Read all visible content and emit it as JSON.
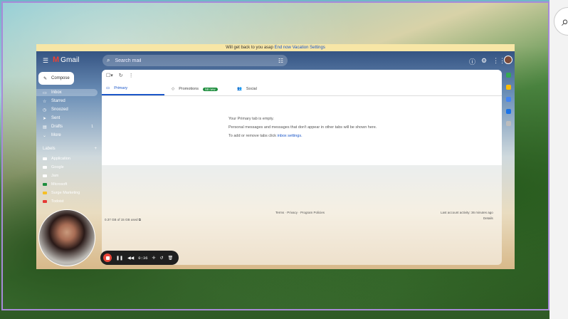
{
  "vacation_bar": {
    "text": "Will get back to you asap ",
    "link1": "End now",
    "link2": "Vacation Settings"
  },
  "app": {
    "logo_text": "Gmail"
  },
  "search": {
    "placeholder": "Search mail"
  },
  "sidebar": {
    "compose": "Compose",
    "items": [
      {
        "label": "Inbox",
        "icon": "inbox-icon",
        "count": ""
      },
      {
        "label": "Starred",
        "icon": "star-icon",
        "count": ""
      },
      {
        "label": "Snoozed",
        "icon": "clock-icon",
        "count": ""
      },
      {
        "label": "Sent",
        "icon": "send-icon",
        "count": ""
      },
      {
        "label": "Drafts",
        "icon": "draft-icon",
        "count": "1"
      },
      {
        "label": "More",
        "icon": "chevron-down-icon",
        "count": ""
      }
    ],
    "labels_title": "Labels",
    "labels": [
      {
        "label": "Application",
        "color": "#ffffff"
      },
      {
        "label": "Google",
        "color": "#ffffff"
      },
      {
        "label": "Jam",
        "color": "#ffffff"
      },
      {
        "label": "Microsoft",
        "color": "#1e8e3e"
      },
      {
        "label": "Surge Marketing",
        "color": "#f6bf26"
      },
      {
        "label": "Todoist",
        "color": "#e53935"
      }
    ]
  },
  "tabs": [
    {
      "label": "Primary"
    },
    {
      "label": "Promotions",
      "badge": "58 new"
    },
    {
      "label": "Social"
    }
  ],
  "empty_state": {
    "line1": "Your Primary tab is empty.",
    "line2": "Personal messages and messages that don't appear in other tabs will be shown here.",
    "line3": "To add or remove tabs click ",
    "link": "inbox settings."
  },
  "footer": {
    "storage": "0.37 GB of 15 GB used",
    "links": "Terms · Privacy · Program Policies",
    "activity": "Last account activity: 36 minutes ago",
    "details": "Details"
  },
  "recorder": {
    "timer": "0:36"
  }
}
